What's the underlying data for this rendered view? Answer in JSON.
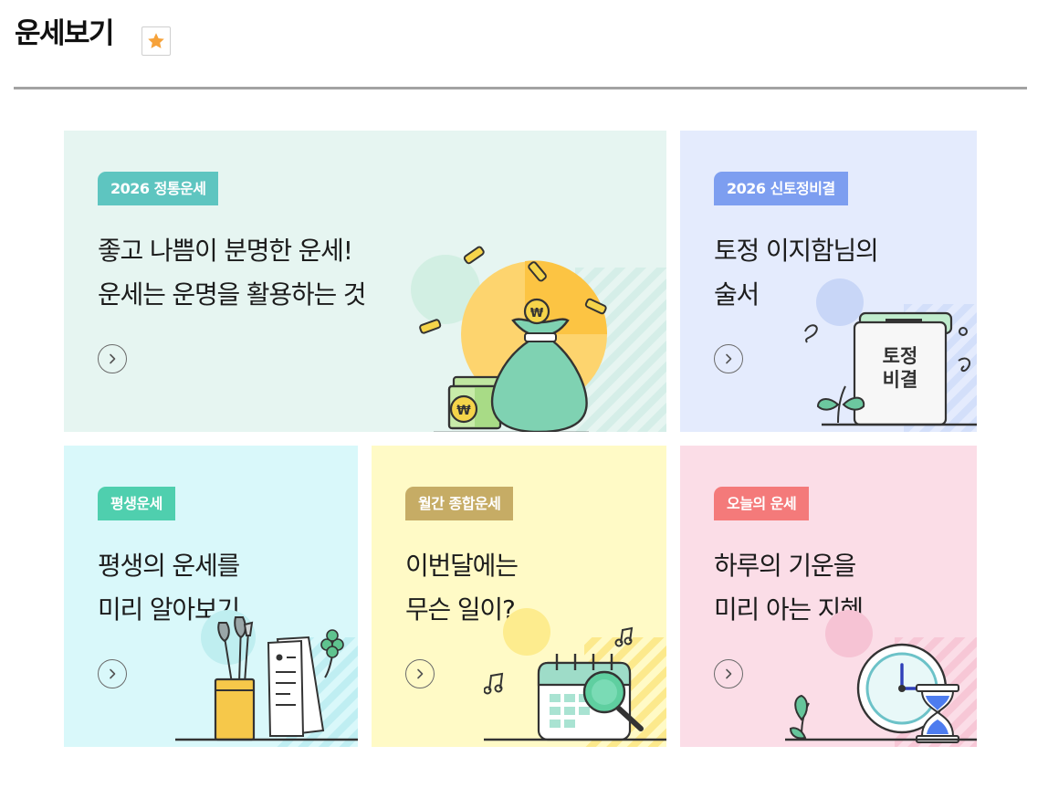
{
  "header": {
    "title": "운세보기",
    "favorite_icon": "star-icon"
  },
  "colors": {
    "star": "#f6a23a",
    "card_bg": [
      "#e6f5f1",
      "#e4ebfd",
      "#d9f8fa",
      "#fffac6",
      "#fbdde7"
    ],
    "tag_bg": [
      "#5ec5c0",
      "#7d9ef0",
      "#4fcfae",
      "#c6ac65",
      "#f47a7a"
    ]
  },
  "cards": [
    {
      "tag": "2026 정통운세",
      "line1": "좋고 나쁨이 분명한 운세!",
      "line2": "운세는 운명을 활용하는 것",
      "icon": "money-bag-coins-icon"
    },
    {
      "tag": "2026 신토정비결",
      "line1": "토정 이지함님의",
      "line2": "술서",
      "icon": "book-icon",
      "book_line1": "토정",
      "book_line2": "비결"
    },
    {
      "tag": "평생운세",
      "line1": "평생의 운세를",
      "line2": "미리 알아보기",
      "icon": "pen-cup-document-icon"
    },
    {
      "tag": "월간 종합운세",
      "line1": "이번달에는",
      "line2": "무슨 일이?",
      "icon": "calendar-magnifier-icon"
    },
    {
      "tag": "오늘의 운세",
      "line1": "하루의 기운을",
      "line2": "미리 아는 지혜",
      "icon": "clock-hourglass-icon"
    }
  ]
}
